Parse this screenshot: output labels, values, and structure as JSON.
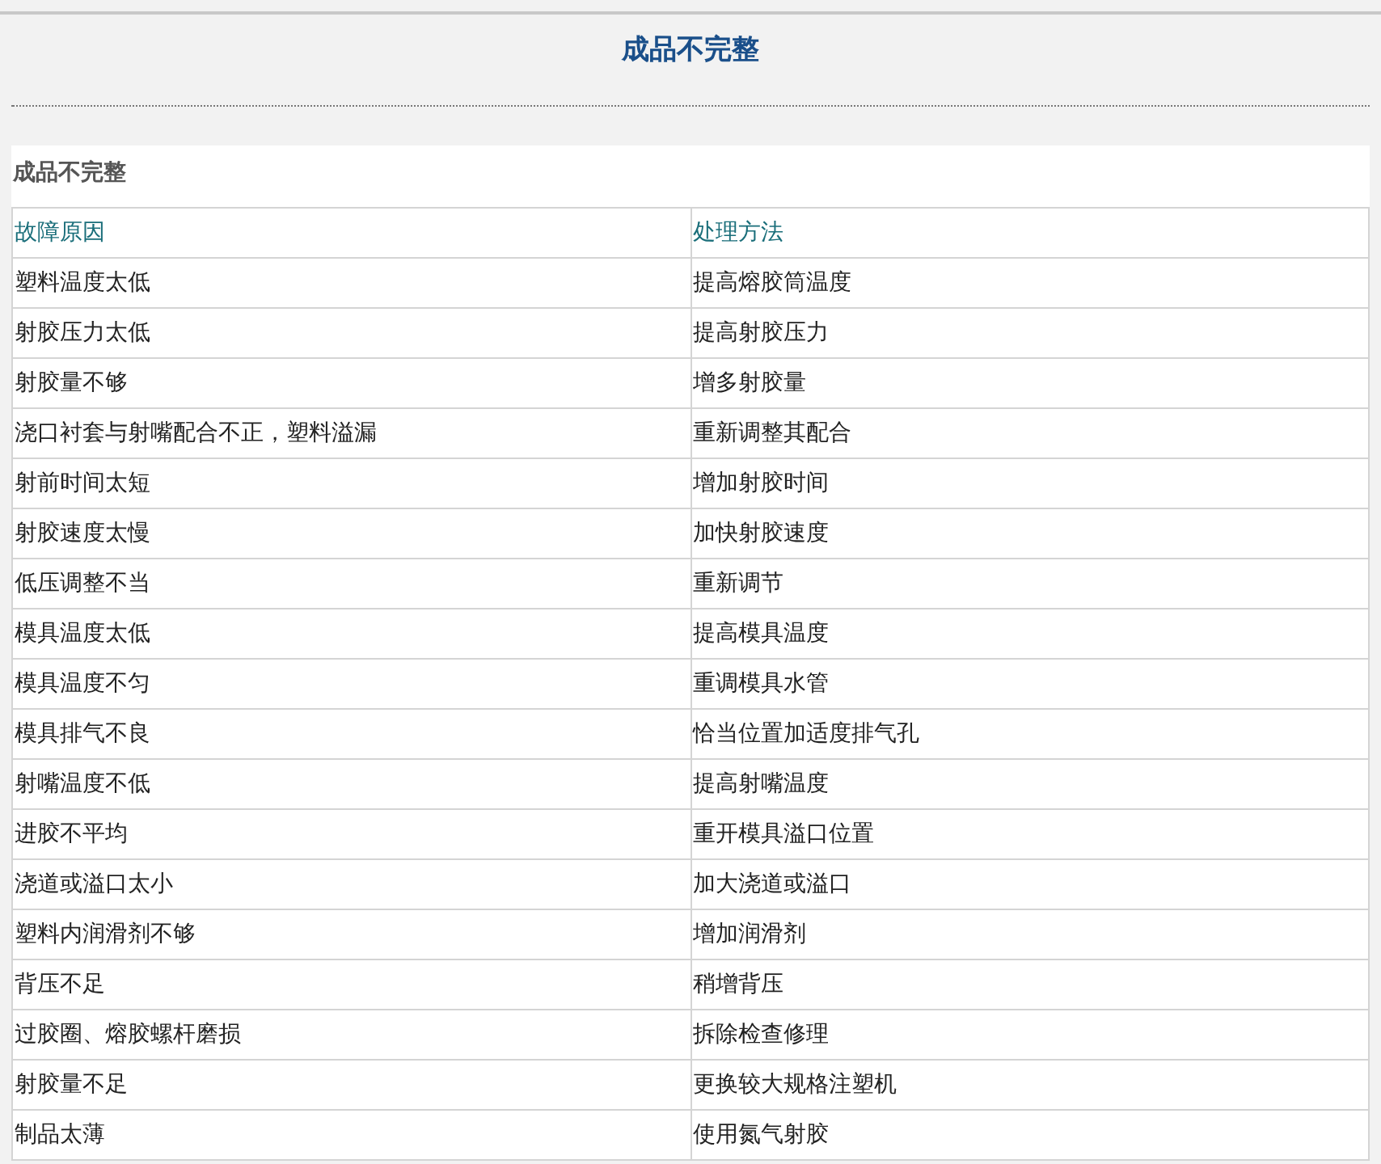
{
  "page_title": "成品不完整",
  "section_title": "成品不完整",
  "table": {
    "columns": [
      "故障原因",
      "处理方法"
    ],
    "rows": [
      [
        "塑料温度太低",
        "提高熔胶筒温度"
      ],
      [
        "射胶压力太低",
        "提高射胶压力"
      ],
      [
        "射胶量不够",
        "增多射胶量"
      ],
      [
        "浇口衬套与射嘴配合不正，塑料溢漏",
        "重新调整其配合"
      ],
      [
        "射前时间太短",
        "增加射胶时间"
      ],
      [
        "射胶速度太慢",
        "加快射胶速度"
      ],
      [
        "低压调整不当",
        "重新调节"
      ],
      [
        "模具温度太低",
        "提高模具温度"
      ],
      [
        "模具温度不匀",
        "重调模具水管"
      ],
      [
        "模具排气不良",
        "恰当位置加适度排气孔"
      ],
      [
        "射嘴温度不低",
        "提高射嘴温度"
      ],
      [
        "进胶不平均",
        "重开模具溢口位置"
      ],
      [
        "浇道或溢口太小",
        "加大浇道或溢口"
      ],
      [
        "塑料内润滑剂不够",
        "增加润滑剂"
      ],
      [
        "背压不足",
        "稍增背压"
      ],
      [
        "过胶圈、熔胶螺杆磨损",
        "拆除检查修理"
      ],
      [
        "射胶量不足",
        "更换较大规格注塑机"
      ],
      [
        "制品太薄",
        "使用氮气射胶"
      ]
    ]
  }
}
